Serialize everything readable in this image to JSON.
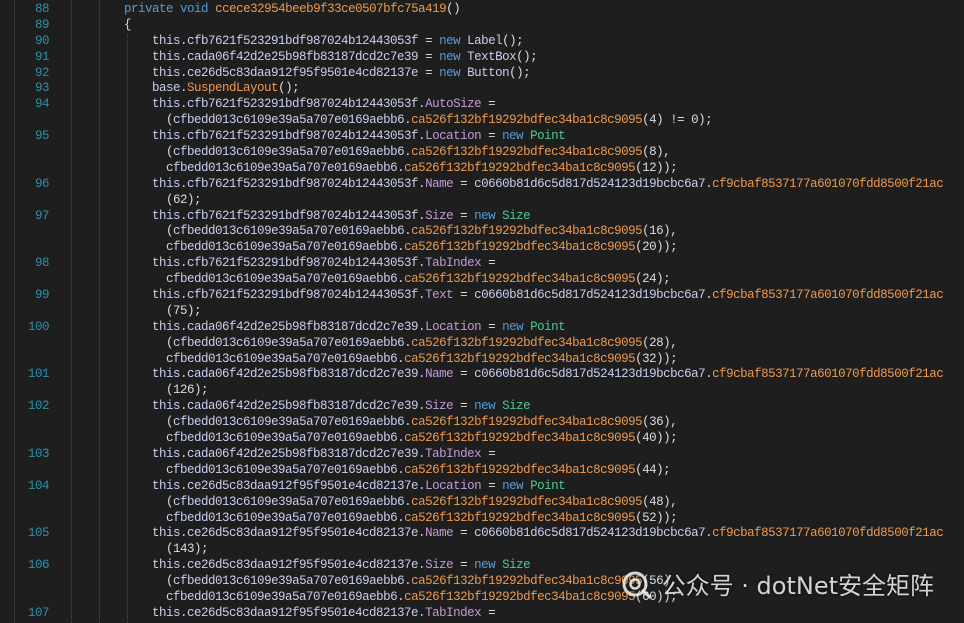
{
  "theme": {
    "background": "#1e1e1e",
    "line_number_color": "#2b91af"
  },
  "editor": {
    "lines": [
      {
        "number": "88",
        "tokens": [
          [
            "#dcdcdc",
            "        "
          ],
          [
            "#569cd6",
            "private"
          ],
          [
            "#dcdcdc",
            " "
          ],
          [
            "#569cd6",
            "void"
          ],
          [
            "#dcdcdc",
            " "
          ],
          [
            "#ee9a4d",
            "ccece32954beeb9f33ce0507bfc75a419"
          ],
          [
            "#dcdcdc",
            "()"
          ]
        ]
      },
      {
        "number": "89",
        "tokens": [
          [
            "#dcdcdc",
            "        "
          ],
          [
            "#dcdcdc",
            "{"
          ]
        ]
      },
      {
        "number": "90",
        "tokens": [
          [
            "#dcdcdc",
            "            "
          ],
          [
            "#c9cfee",
            "this.cfb7621f523291bdf987024b12443053f"
          ],
          [
            "#dcdcdc",
            " = "
          ],
          [
            "#569cd6",
            "new"
          ],
          [
            "#dcdcdc",
            " "
          ],
          [
            "#c9cfee",
            "Label"
          ],
          [
            "#dcdcdc",
            "();"
          ]
        ]
      },
      {
        "number": "91",
        "tokens": [
          [
            "#dcdcdc",
            "            "
          ],
          [
            "#c9cfee",
            "this.cada06f42d2e25b98fb83187dcd2c7e39"
          ],
          [
            "#dcdcdc",
            " = "
          ],
          [
            "#569cd6",
            "new"
          ],
          [
            "#dcdcdc",
            " "
          ],
          [
            "#c9cfee",
            "TextBox"
          ],
          [
            "#dcdcdc",
            "();"
          ]
        ]
      },
      {
        "number": "92",
        "tokens": [
          [
            "#dcdcdc",
            "            "
          ],
          [
            "#c9cfee",
            "this.ce26d5c83daa912f95f9501e4cd82137e"
          ],
          [
            "#dcdcdc",
            " = "
          ],
          [
            "#569cd6",
            "new"
          ],
          [
            "#dcdcdc",
            " "
          ],
          [
            "#c9cfee",
            "Button"
          ],
          [
            "#dcdcdc",
            "();"
          ]
        ]
      },
      {
        "number": "93",
        "tokens": [
          [
            "#dcdcdc",
            "            "
          ],
          [
            "#c9cfee",
            "base."
          ],
          [
            "#ee9a4d",
            "SuspendLayout"
          ],
          [
            "#dcdcdc",
            "();"
          ]
        ]
      },
      {
        "number": "94",
        "tokens": [
          [
            "#dcdcdc",
            "            "
          ],
          [
            "#c9cfee",
            "this.cfb7621f523291bdf987024b12443053f."
          ],
          [
            "#c49bd8",
            "AutoSize"
          ],
          [
            "#dcdcdc",
            " ="
          ]
        ]
      },
      {
        "tokens": [
          [
            "#dcdcdc",
            "              "
          ],
          [
            "#dcdcdc",
            "("
          ],
          [
            "#c9cfee",
            "cfbedd013c6109e39a5a707e0169aebb6."
          ],
          [
            "#ee9a4d",
            "ca526f132bf19292bdfec34ba1c8c9095"
          ],
          [
            "#dcdcdc",
            "(4) != 0);"
          ]
        ]
      },
      {
        "number": "95",
        "tokens": [
          [
            "#dcdcdc",
            "            "
          ],
          [
            "#c9cfee",
            "this.cfb7621f523291bdf987024b12443053f."
          ],
          [
            "#c49bd8",
            "Location"
          ],
          [
            "#dcdcdc",
            " = "
          ],
          [
            "#569cd6",
            "new"
          ],
          [
            "#dcdcdc",
            " "
          ],
          [
            "#4ec98f",
            "Point"
          ]
        ]
      },
      {
        "tokens": [
          [
            "#dcdcdc",
            "              "
          ],
          [
            "#dcdcdc",
            "("
          ],
          [
            "#c9cfee",
            "cfbedd013c6109e39a5a707e0169aebb6."
          ],
          [
            "#ee9a4d",
            "ca526f132bf19292bdfec34ba1c8c9095"
          ],
          [
            "#dcdcdc",
            "(8),"
          ]
        ]
      },
      {
        "tokens": [
          [
            "#dcdcdc",
            "              "
          ],
          [
            "#c9cfee",
            "cfbedd013c6109e39a5a707e0169aebb6."
          ],
          [
            "#ee9a4d",
            "ca526f132bf19292bdfec34ba1c8c9095"
          ],
          [
            "#dcdcdc",
            "(12));"
          ]
        ]
      },
      {
        "number": "96",
        "tokens": [
          [
            "#dcdcdc",
            "            "
          ],
          [
            "#c9cfee",
            "this.cfb7621f523291bdf987024b12443053f."
          ],
          [
            "#c49bd8",
            "Name"
          ],
          [
            "#dcdcdc",
            " = "
          ],
          [
            "#c9cfee",
            "c0660b81d6c5d817d524123d19bcbc6a7."
          ],
          [
            "#ee9a4d",
            "cf9cbaf8537177a601070fdd8500f21ac"
          ]
        ]
      },
      {
        "tokens": [
          [
            "#dcdcdc",
            "              "
          ],
          [
            "#dcdcdc",
            "(62);"
          ]
        ]
      },
      {
        "number": "97",
        "tokens": [
          [
            "#dcdcdc",
            "            "
          ],
          [
            "#c9cfee",
            "this.cfb7621f523291bdf987024b12443053f."
          ],
          [
            "#c49bd8",
            "Size"
          ],
          [
            "#dcdcdc",
            " = "
          ],
          [
            "#569cd6",
            "new"
          ],
          [
            "#dcdcdc",
            " "
          ],
          [
            "#4ec98f",
            "Size"
          ]
        ]
      },
      {
        "tokens": [
          [
            "#dcdcdc",
            "              "
          ],
          [
            "#dcdcdc",
            "("
          ],
          [
            "#c9cfee",
            "cfbedd013c6109e39a5a707e0169aebb6."
          ],
          [
            "#ee9a4d",
            "ca526f132bf19292bdfec34ba1c8c9095"
          ],
          [
            "#dcdcdc",
            "(16),"
          ]
        ]
      },
      {
        "tokens": [
          [
            "#dcdcdc",
            "              "
          ],
          [
            "#c9cfee",
            "cfbedd013c6109e39a5a707e0169aebb6."
          ],
          [
            "#ee9a4d",
            "ca526f132bf19292bdfec34ba1c8c9095"
          ],
          [
            "#dcdcdc",
            "(20));"
          ]
        ]
      },
      {
        "number": "98",
        "tokens": [
          [
            "#dcdcdc",
            "            "
          ],
          [
            "#c9cfee",
            "this.cfb7621f523291bdf987024b12443053f."
          ],
          [
            "#c49bd8",
            "TabIndex"
          ],
          [
            "#dcdcdc",
            " ="
          ]
        ]
      },
      {
        "tokens": [
          [
            "#dcdcdc",
            "              "
          ],
          [
            "#c9cfee",
            "cfbedd013c6109e39a5a707e0169aebb6."
          ],
          [
            "#ee9a4d",
            "ca526f132bf19292bdfec34ba1c8c9095"
          ],
          [
            "#dcdcdc",
            "(24);"
          ]
        ]
      },
      {
        "number": "99",
        "tokens": [
          [
            "#dcdcdc",
            "            "
          ],
          [
            "#c9cfee",
            "this.cfb7621f523291bdf987024b12443053f."
          ],
          [
            "#c49bd8",
            "Text"
          ],
          [
            "#dcdcdc",
            " = "
          ],
          [
            "#c9cfee",
            "c0660b81d6c5d817d524123d19bcbc6a7."
          ],
          [
            "#ee9a4d",
            "cf9cbaf8537177a601070fdd8500f21ac"
          ]
        ]
      },
      {
        "tokens": [
          [
            "#dcdcdc",
            "              "
          ],
          [
            "#dcdcdc",
            "(75);"
          ]
        ]
      },
      {
        "number": "100",
        "tokens": [
          [
            "#dcdcdc",
            "            "
          ],
          [
            "#c9cfee",
            "this.cada06f42d2e25b98fb83187dcd2c7e39."
          ],
          [
            "#c49bd8",
            "Location"
          ],
          [
            "#dcdcdc",
            " = "
          ],
          [
            "#569cd6",
            "new"
          ],
          [
            "#dcdcdc",
            " "
          ],
          [
            "#4ec98f",
            "Point"
          ]
        ]
      },
      {
        "tokens": [
          [
            "#dcdcdc",
            "              "
          ],
          [
            "#dcdcdc",
            "("
          ],
          [
            "#c9cfee",
            "cfbedd013c6109e39a5a707e0169aebb6."
          ],
          [
            "#ee9a4d",
            "ca526f132bf19292bdfec34ba1c8c9095"
          ],
          [
            "#dcdcdc",
            "(28),"
          ]
        ]
      },
      {
        "tokens": [
          [
            "#dcdcdc",
            "              "
          ],
          [
            "#c9cfee",
            "cfbedd013c6109e39a5a707e0169aebb6."
          ],
          [
            "#ee9a4d",
            "ca526f132bf19292bdfec34ba1c8c9095"
          ],
          [
            "#dcdcdc",
            "(32));"
          ]
        ]
      },
      {
        "number": "101",
        "tokens": [
          [
            "#dcdcdc",
            "            "
          ],
          [
            "#c9cfee",
            "this.cada06f42d2e25b98fb83187dcd2c7e39."
          ],
          [
            "#c49bd8",
            "Name"
          ],
          [
            "#dcdcdc",
            " = "
          ],
          [
            "#c9cfee",
            "c0660b81d6c5d817d524123d19bcbc6a7."
          ],
          [
            "#ee9a4d",
            "cf9cbaf8537177a601070fdd8500f21ac"
          ]
        ]
      },
      {
        "tokens": [
          [
            "#dcdcdc",
            "              "
          ],
          [
            "#dcdcdc",
            "(126);"
          ]
        ]
      },
      {
        "number": "102",
        "tokens": [
          [
            "#dcdcdc",
            "            "
          ],
          [
            "#c9cfee",
            "this.cada06f42d2e25b98fb83187dcd2c7e39."
          ],
          [
            "#c49bd8",
            "Size"
          ],
          [
            "#dcdcdc",
            " = "
          ],
          [
            "#569cd6",
            "new"
          ],
          [
            "#dcdcdc",
            " "
          ],
          [
            "#4ec98f",
            "Size"
          ]
        ]
      },
      {
        "tokens": [
          [
            "#dcdcdc",
            "              "
          ],
          [
            "#dcdcdc",
            "("
          ],
          [
            "#c9cfee",
            "cfbedd013c6109e39a5a707e0169aebb6."
          ],
          [
            "#ee9a4d",
            "ca526f132bf19292bdfec34ba1c8c9095"
          ],
          [
            "#dcdcdc",
            "(36),"
          ]
        ]
      },
      {
        "tokens": [
          [
            "#dcdcdc",
            "              "
          ],
          [
            "#c9cfee",
            "cfbedd013c6109e39a5a707e0169aebb6."
          ],
          [
            "#ee9a4d",
            "ca526f132bf19292bdfec34ba1c8c9095"
          ],
          [
            "#dcdcdc",
            "(40));"
          ]
        ]
      },
      {
        "number": "103",
        "tokens": [
          [
            "#dcdcdc",
            "            "
          ],
          [
            "#c9cfee",
            "this.cada06f42d2e25b98fb83187dcd2c7e39."
          ],
          [
            "#c49bd8",
            "TabIndex"
          ],
          [
            "#dcdcdc",
            " ="
          ]
        ]
      },
      {
        "tokens": [
          [
            "#dcdcdc",
            "              "
          ],
          [
            "#c9cfee",
            "cfbedd013c6109e39a5a707e0169aebb6."
          ],
          [
            "#ee9a4d",
            "ca526f132bf19292bdfec34ba1c8c9095"
          ],
          [
            "#dcdcdc",
            "(44);"
          ]
        ]
      },
      {
        "number": "104",
        "tokens": [
          [
            "#dcdcdc",
            "            "
          ],
          [
            "#c9cfee",
            "this.ce26d5c83daa912f95f9501e4cd82137e."
          ],
          [
            "#c49bd8",
            "Location"
          ],
          [
            "#dcdcdc",
            " = "
          ],
          [
            "#569cd6",
            "new"
          ],
          [
            "#dcdcdc",
            " "
          ],
          [
            "#4ec98f",
            "Point"
          ]
        ]
      },
      {
        "tokens": [
          [
            "#dcdcdc",
            "              "
          ],
          [
            "#dcdcdc",
            "("
          ],
          [
            "#c9cfee",
            "cfbedd013c6109e39a5a707e0169aebb6."
          ],
          [
            "#ee9a4d",
            "ca526f132bf19292bdfec34ba1c8c9095"
          ],
          [
            "#dcdcdc",
            "(48),"
          ]
        ]
      },
      {
        "tokens": [
          [
            "#dcdcdc",
            "              "
          ],
          [
            "#c9cfee",
            "cfbedd013c6109e39a5a707e0169aebb6."
          ],
          [
            "#ee9a4d",
            "ca526f132bf19292bdfec34ba1c8c9095"
          ],
          [
            "#dcdcdc",
            "(52));"
          ]
        ]
      },
      {
        "number": "105",
        "tokens": [
          [
            "#dcdcdc",
            "            "
          ],
          [
            "#c9cfee",
            "this.ce26d5c83daa912f95f9501e4cd82137e."
          ],
          [
            "#c49bd8",
            "Name"
          ],
          [
            "#dcdcdc",
            " = "
          ],
          [
            "#c9cfee",
            "c0660b81d6c5d817d524123d19bcbc6a7."
          ],
          [
            "#ee9a4d",
            "cf9cbaf8537177a601070fdd8500f21ac"
          ]
        ]
      },
      {
        "tokens": [
          [
            "#dcdcdc",
            "              "
          ],
          [
            "#dcdcdc",
            "(143);"
          ]
        ]
      },
      {
        "number": "106",
        "tokens": [
          [
            "#dcdcdc",
            "            "
          ],
          [
            "#c9cfee",
            "this.ce26d5c83daa912f95f9501e4cd82137e."
          ],
          [
            "#c49bd8",
            "Size"
          ],
          [
            "#dcdcdc",
            " = "
          ],
          [
            "#569cd6",
            "new"
          ],
          [
            "#dcdcdc",
            " "
          ],
          [
            "#4ec98f",
            "Size"
          ]
        ]
      },
      {
        "tokens": [
          [
            "#dcdcdc",
            "              "
          ],
          [
            "#dcdcdc",
            "("
          ],
          [
            "#c9cfee",
            "cfbedd013c6109e39a5a707e0169aebb6."
          ],
          [
            "#ee9a4d",
            "ca526f132bf19292bdfec34ba1c8c9095"
          ],
          [
            "#dcdcdc",
            "(56),"
          ]
        ]
      },
      {
        "tokens": [
          [
            "#dcdcdc",
            "              "
          ],
          [
            "#c9cfee",
            "cfbedd013c6109e39a5a707e0169aebb6."
          ],
          [
            "#ee9a4d",
            "ca526f132bf19292bdfec34ba1c8c9095"
          ],
          [
            "#dcdcdc",
            "(60));"
          ]
        ]
      },
      {
        "number": "107",
        "tokens": [
          [
            "#dcdcdc",
            "            "
          ],
          [
            "#c9cfee",
            "this.ce26d5c83daa912f95f9501e4cd82137e."
          ],
          [
            "#c49bd8",
            "TabIndex"
          ],
          [
            "#dcdcdc",
            " ="
          ]
        ]
      }
    ]
  },
  "watermark": {
    "icon": "wechat-official-account-icon",
    "label": "公众号 · dotNet安全矩阵"
  }
}
